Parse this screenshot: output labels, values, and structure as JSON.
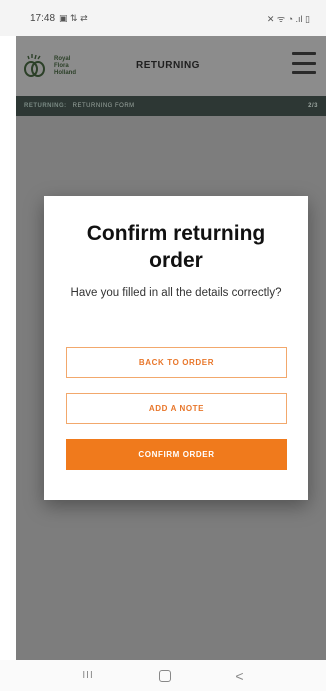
{
  "status_bar": {
    "time": "17:48",
    "left_icons": "▣ ⇅ ⇄",
    "right_icons": "✕ ᯤ ◔ .ıl ▯"
  },
  "header": {
    "logo_lines": [
      "Royal",
      "Flora",
      "Holland"
    ],
    "title": "RETURNING"
  },
  "breadcrumb": {
    "section": "RETURNING:",
    "current": "RETURNING FORM",
    "step": "2/3"
  },
  "modal": {
    "title": "Confirm returning order",
    "text": "Have you filled in all the details correctly?",
    "back_label": "BACK TO ORDER",
    "note_label": "ADD A NOTE",
    "confirm_label": "CONFIRM ORDER"
  },
  "colors": {
    "accent": "#f07a1c",
    "breadcrumb_bg": "#2d3734",
    "overlay": "#7d7d7d"
  },
  "navbar": {
    "recents": "III",
    "back": "<"
  }
}
